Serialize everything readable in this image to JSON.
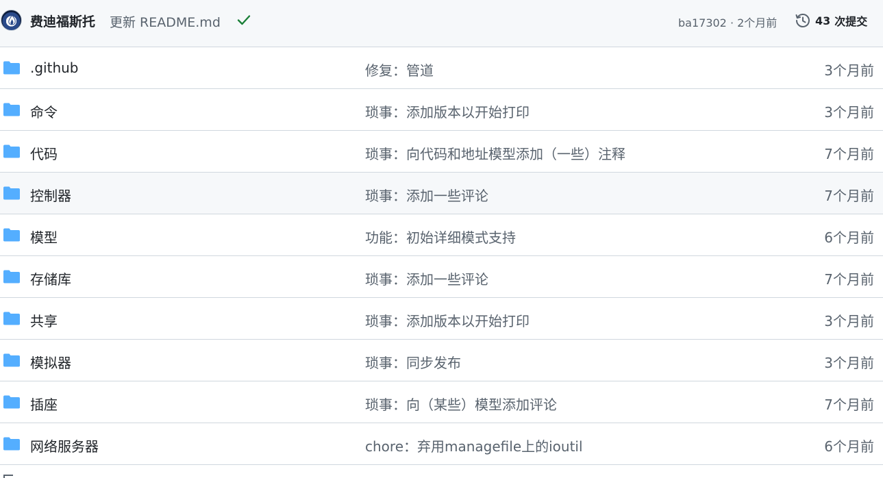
{
  "header": {
    "author": "费迪福斯托",
    "commit_message": "更新 README.md",
    "status_icon": "check-icon",
    "sha_time": "ba17302 · 2个月前",
    "history_count": "43",
    "history_label": "次提交",
    "history_icon": "history-icon",
    "check_color": "#1a7f37"
  },
  "files": [
    {
      "name": ".github",
      "message": "修复：管道",
      "age": "3个月前"
    },
    {
      "name": "命令",
      "message": "琐事：添加版本以开始打印",
      "age": "3个月前"
    },
    {
      "name": "代码",
      "message": "琐事：向代码和地址模型添加（一些）注释",
      "age": "7个月前"
    },
    {
      "name": "控制器",
      "message": "琐事：添加一些评论",
      "age": "7个月前"
    },
    {
      "name": "模型",
      "message": "功能：初始详细模式支持",
      "age": "6个月前"
    },
    {
      "name": "存储库",
      "message": "琐事：添加一些评论",
      "age": "7个月前"
    },
    {
      "name": "共享",
      "message": "琐事：添加版本以开始打印",
      "age": "3个月前"
    },
    {
      "name": "模拟器",
      "message": "琐事：同步发布",
      "age": "3个月前"
    },
    {
      "name": "插座",
      "message": "琐事：向（某些）模型添加评论",
      "age": "7个月前"
    },
    {
      "name": "网络服务器",
      "message": "chore：弃用managefile上的ioutil",
      "age": "6个月前"
    }
  ],
  "folder_icon": "folder-icon",
  "folder_color": "#54aeff"
}
